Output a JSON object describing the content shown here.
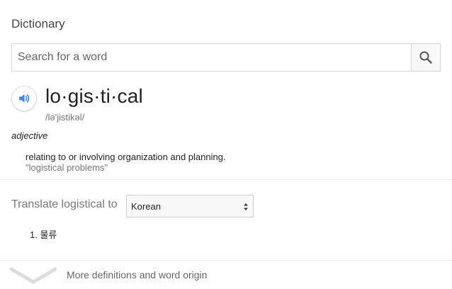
{
  "dictionary": {
    "title": "Dictionary",
    "search": {
      "placeholder": "Search for a word",
      "value": ""
    },
    "entry": {
      "word": "lo·gis·ti·cal",
      "phonetic": "/lə'jistikəl/",
      "part_of_speech": "adjective",
      "definition": "relating to or involving organization and planning.",
      "example": "\"logistical problems\""
    },
    "translate": {
      "label": "Translate logistical to",
      "selected_language": "Korean",
      "results": [
        {
          "number": "1.",
          "text": "물류"
        }
      ]
    },
    "more_link": "More definitions and word origin"
  },
  "colors": {
    "accent_blue": "#4285f4",
    "text_primary": "#222222",
    "text_secondary": "#777777"
  },
  "icons": {
    "search": "search-icon",
    "speaker": "speaker-icon",
    "select_arrows": "updown-arrows-icon",
    "expand": "chevron-down-icon"
  }
}
